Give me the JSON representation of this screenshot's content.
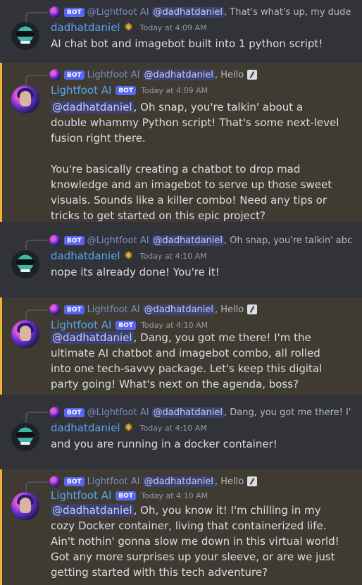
{
  "messages": [
    {
      "reply_bot_tag": "BOT",
      "reply_name": "@Lightfoot AI",
      "reply_mention": "@dadhatdaniel",
      "reply_text": ", That's what's up, my dude",
      "author": "dadhatdaniel",
      "time": "Today at 4:09 AM",
      "mention_text": "",
      "text": "AI chat bot and imagebot built into 1 python script!"
    },
    {
      "reply_bot_tag": "BOT",
      "reply_name": "Lightfoot AI",
      "reply_mention": "@dadhatdaniel",
      "reply_text": ", Hello",
      "author": "Lightfoot AI",
      "author_tag": "BOT",
      "time": "Today at 4:09 AM",
      "mention_text": "@dadhatdaniel",
      "text": ", Oh snap, you're talkin' about a double whammy Python script! That's some next-level fusion right there.",
      "text2": "You're basically creating a chatbot to drop mad knowledge and an imagebot to serve up those sweet visuals. Sounds like a killer combo! Need any tips or tricks to get started on this epic project?"
    },
    {
      "reply_bot_tag": "BOT",
      "reply_name": "@Lightfoot AI",
      "reply_mention": "@dadhatdaniel",
      "reply_text": ", Oh snap, you're talkin' abc",
      "author": "dadhatdaniel",
      "time": "Today at 4:10 AM",
      "mention_text": "",
      "text": "nope its already done! You're it!"
    },
    {
      "reply_bot_tag": "BOT",
      "reply_name": "Lightfoot AI",
      "reply_mention": "@dadhatdaniel",
      "reply_text": ", Hello",
      "author": "Lightfoot AI",
      "author_tag": "BOT",
      "time": "Today at 4:10 AM",
      "mention_text": "@dadhatdaniel",
      "text": ", Dang, you got me there! I'm the ultimate AI chatbot and imagebot combo, all rolled into one tech-savvy package. Let's keep this digital party going! What's next on the agenda, boss?"
    },
    {
      "reply_bot_tag": "BOT",
      "reply_name": "@Lightfoot AI",
      "reply_mention": "@dadhatdaniel",
      "reply_text": ", Dang, you got me there! I'",
      "author": "dadhatdaniel",
      "time": "Today at 4:10 AM",
      "mention_text": "",
      "text": "and you are running in a docker container!"
    },
    {
      "reply_bot_tag": "BOT",
      "reply_name": "Lightfoot AI",
      "reply_mention": "@dadhatdaniel",
      "reply_text": ", Hello",
      "author": "Lightfoot AI",
      "author_tag": "BOT",
      "time": "Today at 4:10 AM",
      "mention_text": "@dadhatdaniel",
      "text": ", Oh, you know it! I'm chilling in my cozy Docker container, living that containerized life. Ain't nothin' gonna slow me down in this virtual world! Got any more surprises up your sleeve, or are we just getting started with this tech adventure?"
    }
  ],
  "colors": {
    "background": "#313338",
    "mention_highlight": "#3f3b33",
    "mention_bar": "#f0b232",
    "username": "#5aa4f0",
    "bot_tag": "#5865f2"
  },
  "icons": {
    "nitro": "nitro-badge-icon",
    "edit": "edited-image-icon"
  }
}
